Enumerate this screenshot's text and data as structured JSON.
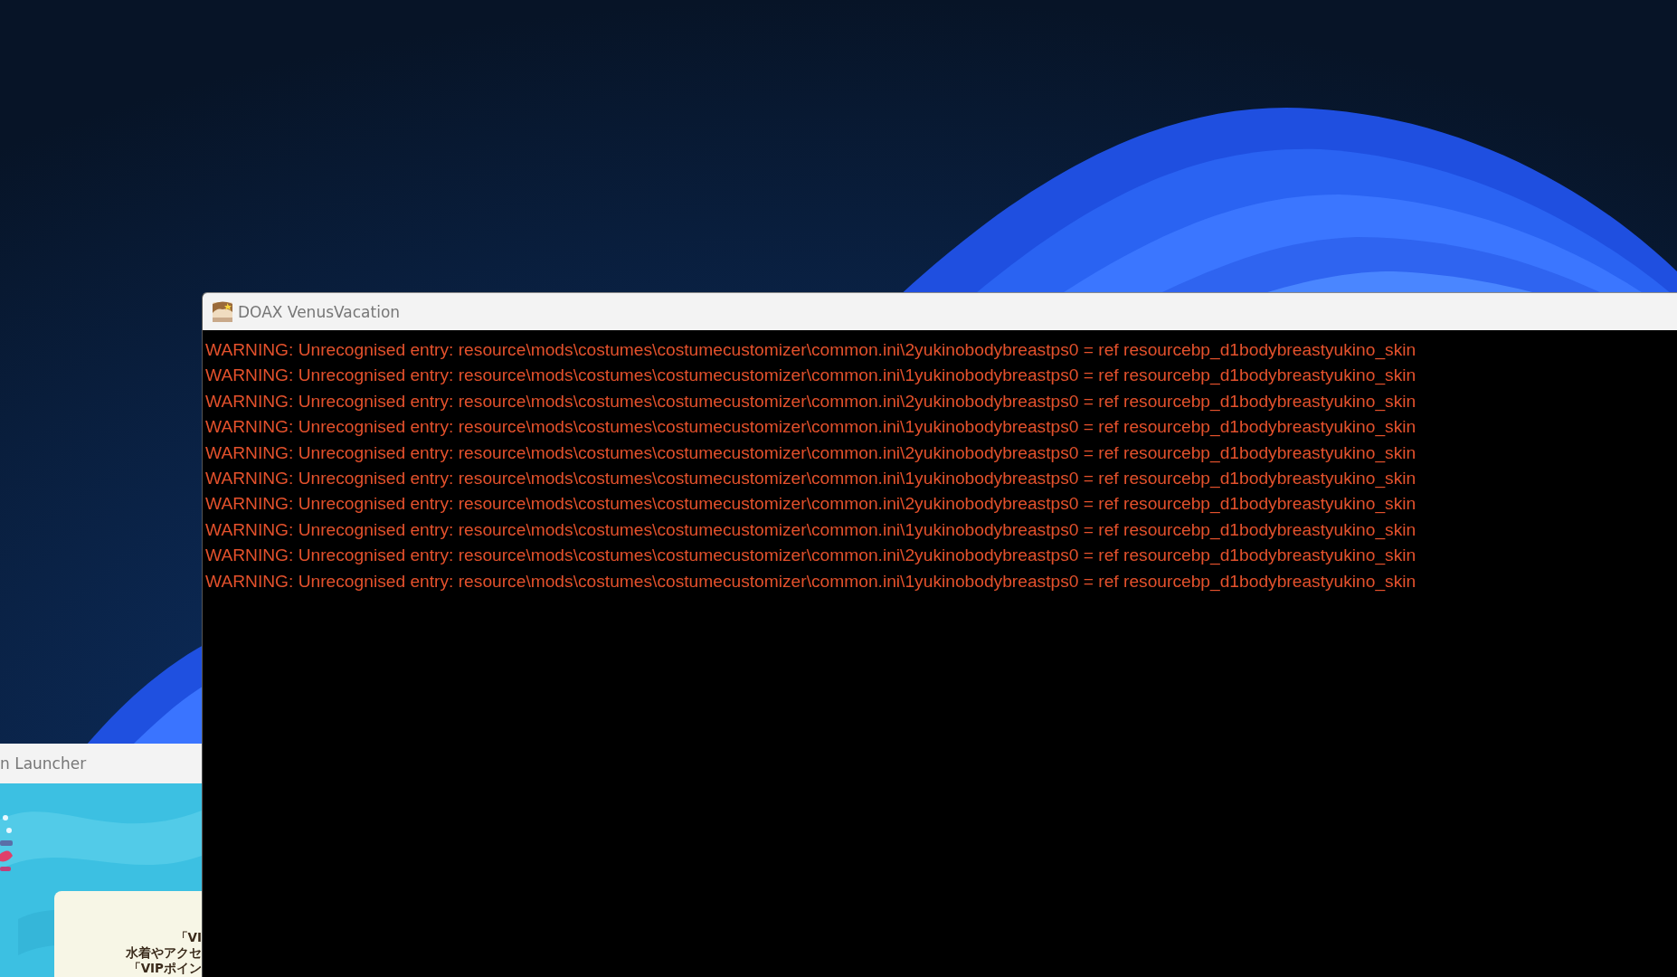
{
  "console_window": {
    "title": "DOAX VenusVacation",
    "lines": [
      "WARNING: Unrecognised entry: resource\\mods\\costumes\\costumecustomizer\\common.ini\\2yukinobodybreastps0 = ref resourcebp_d1bodybreastyukino_skin",
      "WARNING: Unrecognised entry: resource\\mods\\costumes\\costumecustomizer\\common.ini\\1yukinobodybreastps0 = ref resourcebp_d1bodybreastyukino_skin",
      "WARNING: Unrecognised entry: resource\\mods\\costumes\\costumecustomizer\\common.ini\\2yukinobodybreastps0 = ref resourcebp_d1bodybreastyukino_skin",
      "WARNING: Unrecognised entry: resource\\mods\\costumes\\costumecustomizer\\common.ini\\1yukinobodybreastps0 = ref resourcebp_d1bodybreastyukino_skin",
      "WARNING: Unrecognised entry: resource\\mods\\costumes\\costumecustomizer\\common.ini\\2yukinobodybreastps0 = ref resourcebp_d1bodybreastyukino_skin",
      "WARNING: Unrecognised entry: resource\\mods\\costumes\\costumecustomizer\\common.ini\\1yukinobodybreastps0 = ref resourcebp_d1bodybreastyukino_skin",
      "WARNING: Unrecognised entry: resource\\mods\\costumes\\costumecustomizer\\common.ini\\2yukinobodybreastps0 = ref resourcebp_d1bodybreastyukino_skin",
      "WARNING: Unrecognised entry: resource\\mods\\costumes\\costumecustomizer\\common.ini\\1yukinobodybreastps0 = ref resourcebp_d1bodybreastyukino_skin",
      "WARNING: Unrecognised entry: resource\\mods\\costumes\\costumecustomizer\\common.ini\\2yukinobodybreastps0 = ref resourcebp_d1bodybreastyukino_skin",
      "WARNING: Unrecognised entry: resource\\mods\\costumes\\costumecustomizer\\common.ini\\1yukinobodybreastps0 = ref resourcebp_d1bodybreastyukino_skin"
    ]
  },
  "launcher_window": {
    "title": "n Launcher",
    "notice_lines": [
      "「VI",
      "水着やアクセ",
      "「VIPポイン"
    ]
  }
}
